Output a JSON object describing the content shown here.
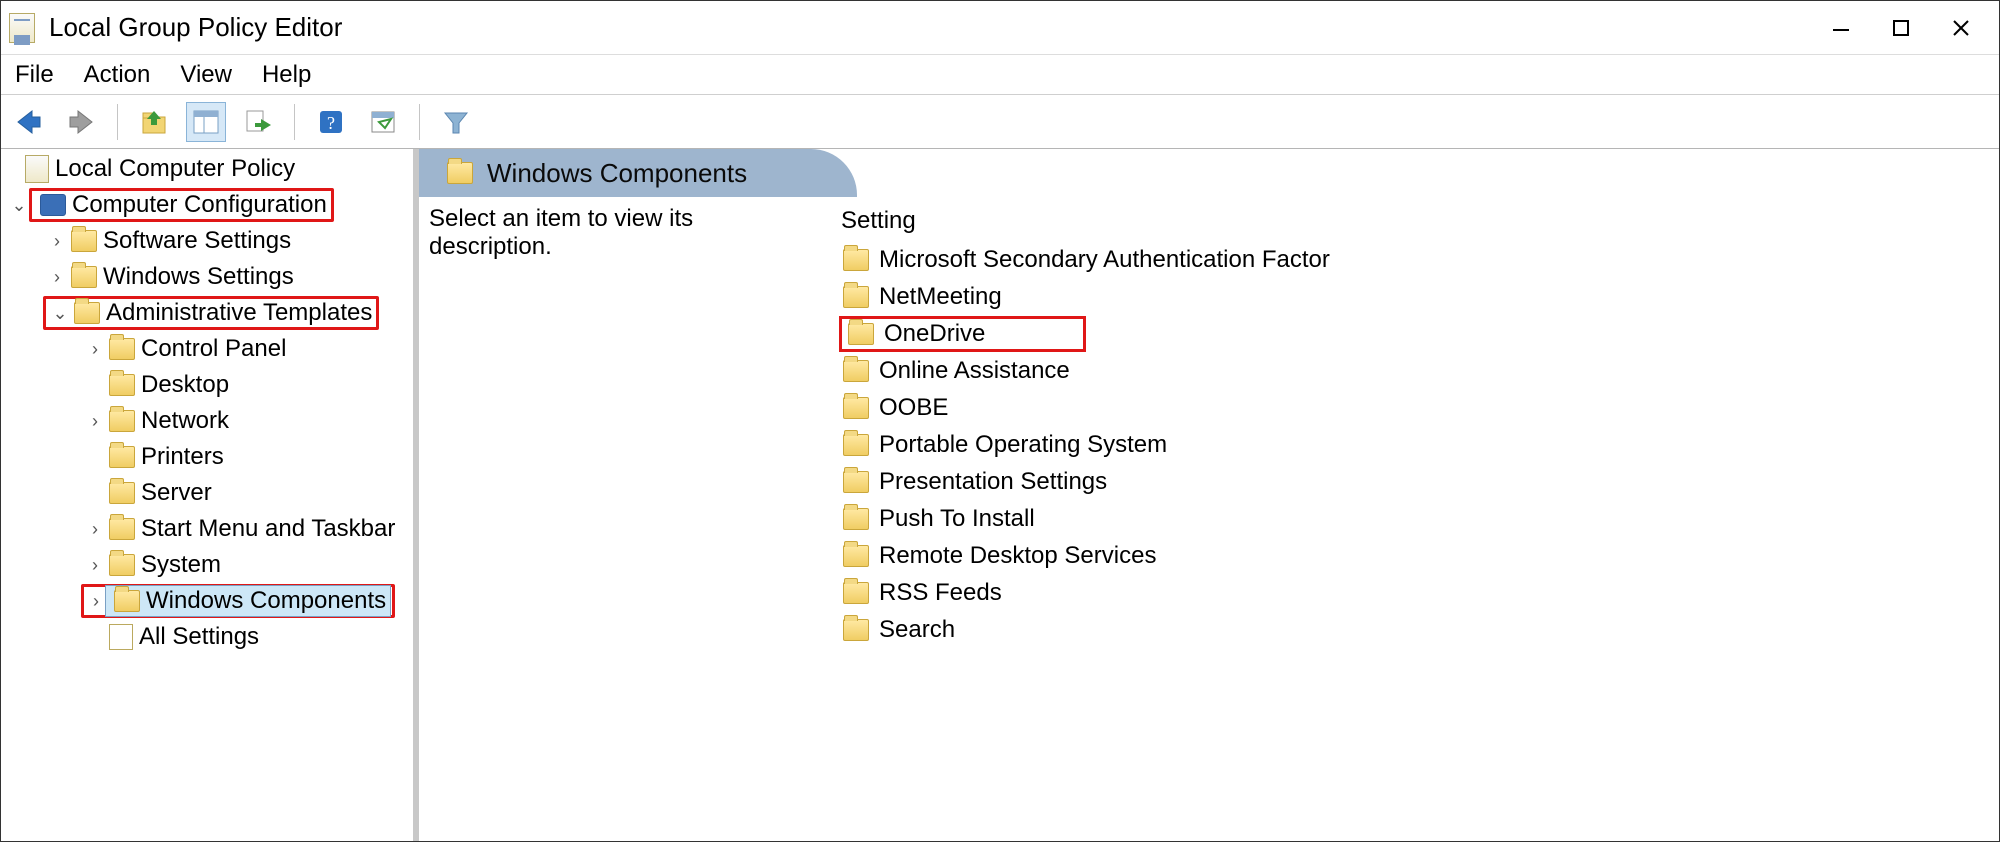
{
  "window": {
    "title": "Local Group Policy Editor"
  },
  "menubar": {
    "items": [
      "File",
      "Action",
      "View",
      "Help"
    ]
  },
  "tree": {
    "root": "Local Computer Policy",
    "computer_config": "Computer Configuration",
    "software_settings": "Software Settings",
    "windows_settings": "Windows Settings",
    "admin_templates": "Administrative Templates",
    "control_panel": "Control Panel",
    "desktop": "Desktop",
    "network": "Network",
    "printers": "Printers",
    "server": "Server",
    "start_menu": "Start Menu and Taskbar",
    "system": "System",
    "windows_components": "Windows Components",
    "all_settings": "All Settings"
  },
  "details": {
    "header": "Windows Components",
    "desc": "Select an item to view its description.",
    "list_header": "Setting",
    "items": [
      "Microsoft Secondary Authentication Factor",
      "NetMeeting",
      "OneDrive",
      "Online Assistance",
      "OOBE",
      "Portable Operating System",
      "Presentation Settings",
      "Push To Install",
      "Remote Desktop Services",
      "RSS Feeds",
      "Search"
    ],
    "highlighted_index": 2
  }
}
